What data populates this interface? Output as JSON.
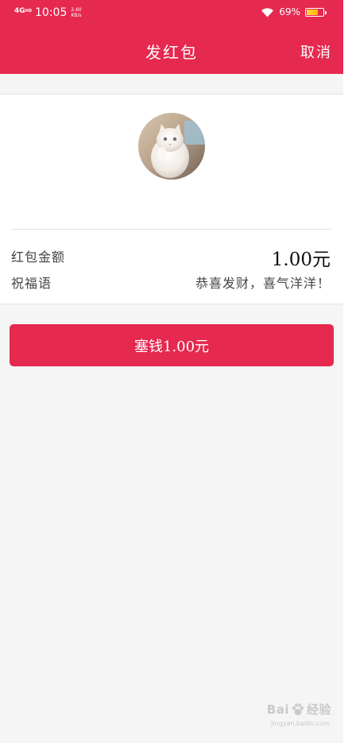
{
  "status_bar": {
    "network": "4G",
    "network_sup": "HD",
    "time": "10:05",
    "speed_value": "2.60",
    "speed_unit": "KB/s",
    "battery_percent": "69%"
  },
  "nav": {
    "title": "发红包",
    "cancel_label": "取消"
  },
  "card": {
    "amount_label": "红包金额",
    "amount_value": "1.00元",
    "blessing_label": "祝福语",
    "blessing_value": "恭喜发财，喜气洋洋！"
  },
  "pay_button_label": "塞钱1.00元",
  "watermark": {
    "text_left": "Bai",
    "text_right": "经验",
    "sub": "jingyan.baidu.com"
  },
  "colors": {
    "brand_red": "#e5294f",
    "background": "#f5f5f5"
  },
  "icons": [
    "wifi-icon",
    "battery-icon",
    "cat-avatar",
    "baidu-paw-icon"
  ]
}
